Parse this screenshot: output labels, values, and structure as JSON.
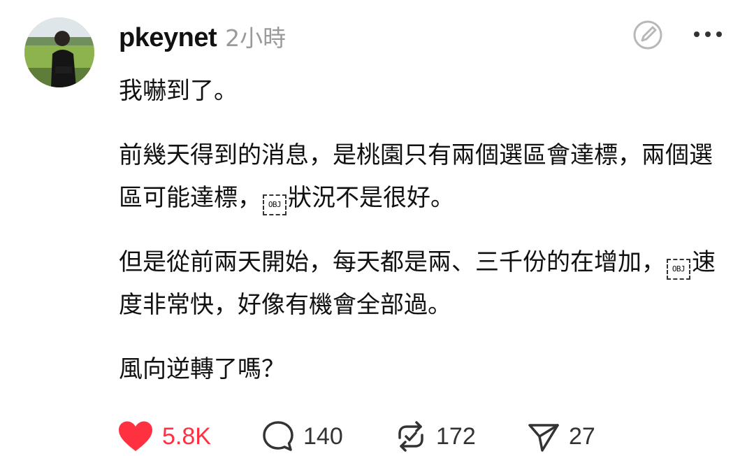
{
  "post": {
    "username": "pkeynet",
    "timestamp": "2小時",
    "paragraphs": [
      [
        "我嚇到了。"
      ],
      [
        "前幾天得到的消息，是桃園只有兩個選區會達標，兩個選區可能達標，",
        "OBJ",
        "狀況不是很好。"
      ],
      [
        "但是從前兩天開始，每天都是兩、三千份的在增加，",
        "OBJ",
        "速度非常快，好像有機會全部過。"
      ],
      [
        "風向逆轉了嗎？"
      ]
    ]
  },
  "actions": {
    "likes": "5.8K",
    "comments": "140",
    "reposts": "172",
    "shares": "27"
  },
  "icons": {
    "avatar": "user-photo",
    "edit": "edit-pencil-icon",
    "more": "more-dots-icon",
    "like": "heart-filled-icon",
    "comment": "comment-bubble-icon",
    "repost": "repost-icon",
    "share": "send-icon"
  },
  "colors": {
    "like": "#ff3040",
    "secondary_text": "#9a9a9a",
    "icon": "#333333"
  }
}
